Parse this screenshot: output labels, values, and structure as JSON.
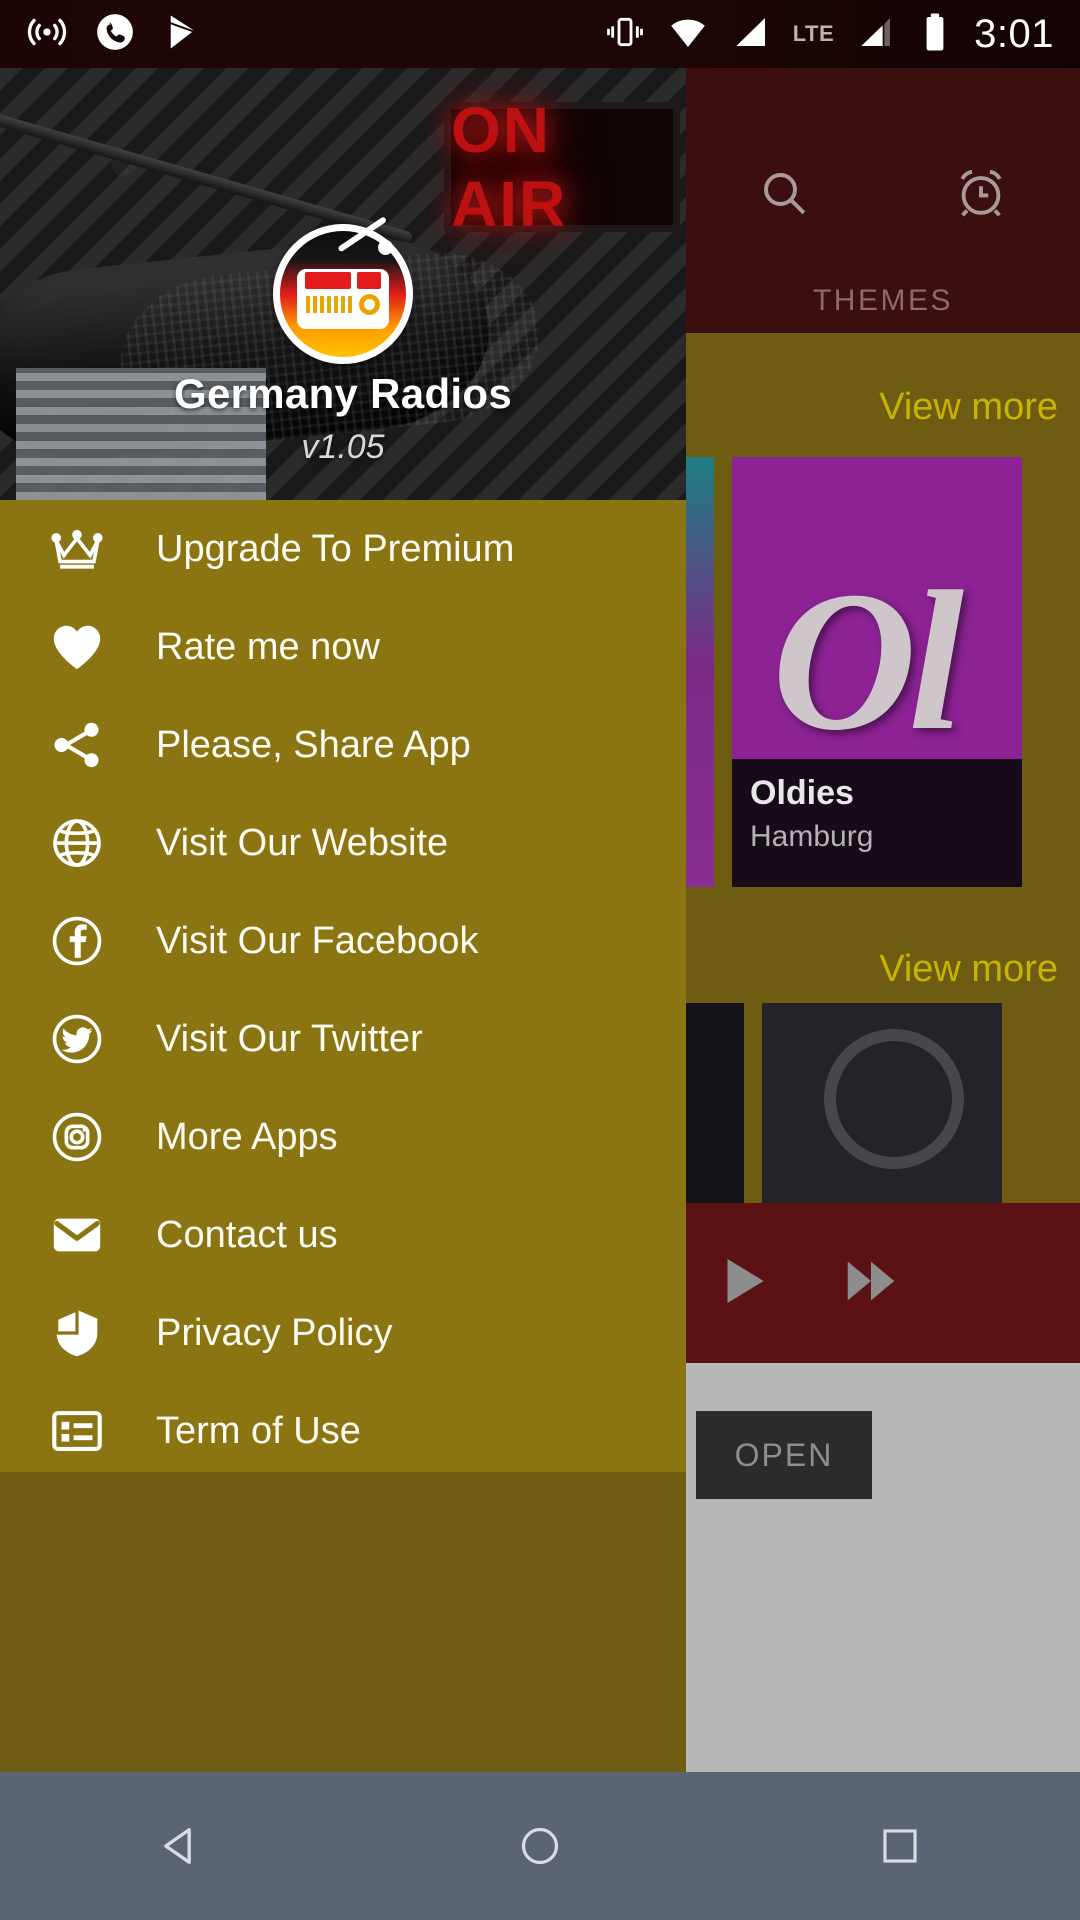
{
  "status_bar": {
    "time": "3:01",
    "network_label": "LTE",
    "left_icons": [
      "cast-icon",
      "phone-icon",
      "play-store-icon"
    ],
    "right_icons": [
      "vibrate-icon",
      "wifi-icon",
      "signal-icon",
      "signal-2-icon",
      "battery-icon"
    ]
  },
  "drawer": {
    "app_title": "Germany Radios",
    "app_version": "v1.05",
    "background_color": "#8b7412",
    "logo_icon": "radio-logo-icon",
    "header_photo_text": "ON AIR",
    "items": [
      {
        "icon": "crown-icon",
        "label": "Upgrade To Premium"
      },
      {
        "icon": "heart-icon",
        "label": "Rate me now"
      },
      {
        "icon": "share-icon",
        "label": "Please, Share App"
      },
      {
        "icon": "globe-icon",
        "label": "Visit Our Website"
      },
      {
        "icon": "facebook-icon",
        "label": "Visit Our Facebook"
      },
      {
        "icon": "twitter-icon",
        "label": "Visit Our Twitter"
      },
      {
        "icon": "instagram-icon",
        "label": "More Apps"
      },
      {
        "icon": "envelope-icon",
        "label": "Contact us"
      },
      {
        "icon": "shield-icon",
        "label": "Privacy Policy"
      },
      {
        "icon": "list-icon",
        "label": "Term of Use"
      }
    ]
  },
  "background_app": {
    "search_icon": "search-icon",
    "alarm_icon": "alarm-clock-icon",
    "tab_label": "THEMES",
    "view_more_1": "View more",
    "view_more_2": "View more",
    "accent_color": "#c8b400",
    "station_card": {
      "title": "Oldies",
      "subtitle": "Hamburg",
      "artwork_text": "Ol"
    },
    "player": {
      "play_icon": "play-icon",
      "next_icon": "fast-forward-icon"
    },
    "open_button": "OPEN"
  },
  "nav_bar": {
    "back": "back-triangle-icon",
    "home": "home-circle-icon",
    "recents": "recents-square-icon"
  }
}
